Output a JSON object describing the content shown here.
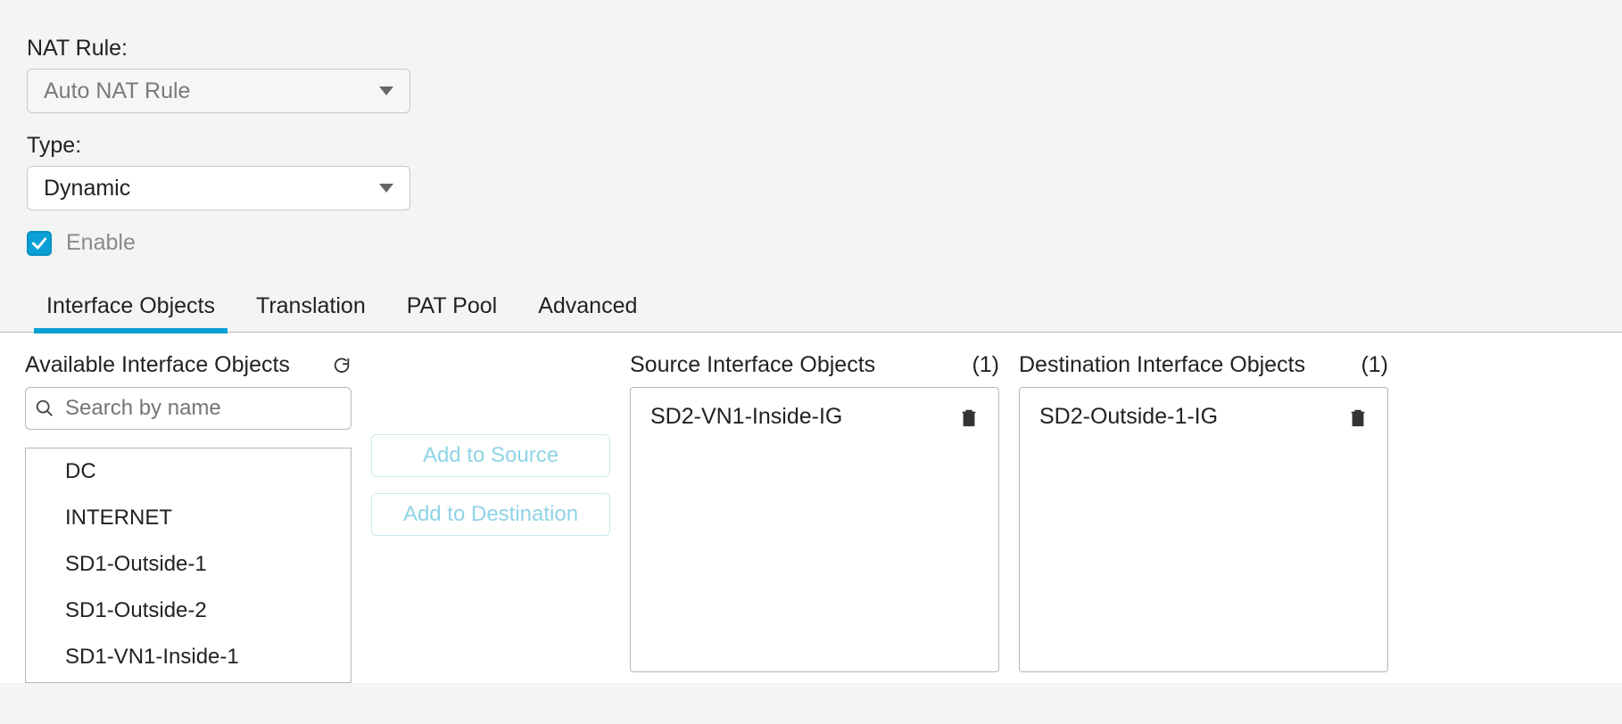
{
  "form": {
    "nat_rule_label": "NAT Rule:",
    "nat_rule_value": "Auto NAT Rule",
    "type_label": "Type:",
    "type_value": "Dynamic",
    "enable_label": "Enable",
    "enable_checked": true
  },
  "tabs": {
    "interface_objects": "Interface Objects",
    "translation": "Translation",
    "pat_pool": "PAT Pool",
    "advanced": "Advanced"
  },
  "available": {
    "header": "Available Interface Objects",
    "search_placeholder": "Search by name",
    "items": {
      "0": "DC",
      "1": "INTERNET",
      "2": "SD1-Outside-1",
      "3": "SD1-Outside-2",
      "4": "SD1-VN1-Inside-1"
    }
  },
  "buttons": {
    "add_source": "Add to Source",
    "add_destination": "Add to Destination"
  },
  "source_panel": {
    "header": "Source Interface Objects",
    "count": "(1)",
    "item": "SD2-VN1-Inside-IG"
  },
  "dest_panel": {
    "header": "Destination Interface Objects",
    "count": "(1)",
    "item": "SD2-Outside-1-IG"
  }
}
